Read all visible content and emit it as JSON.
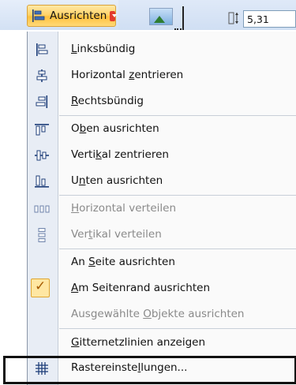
{
  "toolbar": {
    "align_button_label": "Ausrichten",
    "align_icon": "align-left-icon",
    "caret_icon": "chevron-down-icon",
    "picture_icon": "picture-icon",
    "crop_icon": "crop-icon",
    "height_icon": "shape-height-icon",
    "height_value": "5,31"
  },
  "menu": {
    "items": [
      {
        "label_pre": "",
        "label_acc": "L",
        "label_post": "inksbündig",
        "icon": "align-left-icon",
        "enabled": true
      },
      {
        "label_pre": "Horizontal ",
        "label_acc": "z",
        "label_post": "entrieren",
        "icon": "align-center-icon",
        "enabled": true
      },
      {
        "label_pre": "",
        "label_acc": "R",
        "label_post": "echtsbündig",
        "icon": "align-right-icon",
        "enabled": true
      },
      {
        "label_pre": "O",
        "label_acc": "b",
        "label_post": "en ausrichten",
        "icon": "align-top-icon",
        "enabled": true
      },
      {
        "label_pre": "Verti",
        "label_acc": "k",
        "label_post": "al zentrieren",
        "icon": "align-middle-icon",
        "enabled": true
      },
      {
        "label_pre": "U",
        "label_acc": "n",
        "label_post": "ten ausrichten",
        "icon": "align-bottom-icon",
        "enabled": true
      },
      {
        "label_pre": "",
        "label_acc": "H",
        "label_post": "orizontal verteilen",
        "icon": "distribute-horizontal-icon",
        "enabled": false
      },
      {
        "label_pre": "Ver",
        "label_acc": "t",
        "label_post": "ikal verteilen",
        "icon": "distribute-vertical-icon",
        "enabled": false
      },
      {
        "label_pre": "An ",
        "label_acc": "S",
        "label_post": "eite ausrichten",
        "icon": "",
        "enabled": true
      },
      {
        "label_pre": "",
        "label_acc": "A",
        "label_post": "m Seitenrand ausrichten",
        "icon": "checkmark-icon",
        "enabled": true,
        "checked": true
      },
      {
        "label_pre": "Ausgewählte ",
        "label_acc": "O",
        "label_post": "bjekte ausrichten",
        "icon": "",
        "enabled": false
      },
      {
        "label_pre": "",
        "label_acc": "G",
        "label_post": "itternetzlinien anzeigen",
        "icon": "",
        "enabled": true
      },
      {
        "label_pre": "Rastereinste",
        "label_acc": "l",
        "label_post": "lungen...",
        "icon": "grid-icon",
        "enabled": true,
        "highlighted": true
      }
    ]
  },
  "colors": {
    "button_accent": "#ffc13f",
    "caret_red": "#e23b2c",
    "disabled_text": "#8a8a8a",
    "check_bg": "#ffe7a2"
  }
}
